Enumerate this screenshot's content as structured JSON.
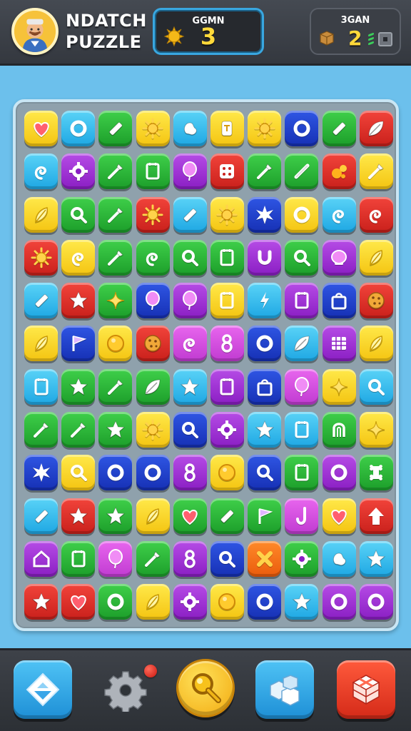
{
  "header": {
    "title_line1": "NDATCH",
    "title_line2": "PUZZLE",
    "score": {
      "label": "GGMN",
      "value": "3"
    },
    "moves": {
      "label": "3GAN",
      "value": "2"
    }
  },
  "colors": {
    "yellow": "#f4c411",
    "blue": "#1ea7e3",
    "green": "#1c9e2a",
    "red": "#c9201b",
    "purple": "#8a1ec3",
    "navy": "#1630b4",
    "orange": "#ea5b0c",
    "magenta": "#c03bd1",
    "board": "#8fa1ac",
    "background": "#6cc0ec"
  },
  "board": {
    "rows": 12,
    "cols": 10,
    "tiles": [
      [
        "yellow:heart",
        "blue:ring",
        "green:bar",
        "yellow:sun",
        "blue:bean",
        "yellow:tag",
        "yellow:sun",
        "navy:ring",
        "green:bar",
        "red:leaf"
      ],
      [
        "blue:swirl",
        "purple:gear",
        "green:wand",
        "green:note",
        "purple:balloon",
        "red:dice",
        "green:wand",
        "green:needle",
        "red:splat",
        "yellow:wand"
      ],
      [
        "yellow:feather",
        "green:magnifier",
        "green:wand",
        "red:sun",
        "blue:bar",
        "yellow:sun",
        "navy:burst",
        "yellow:ring",
        "blue:swirl",
        "red:swirl"
      ],
      [
        "red:sun",
        "yellow:swirl",
        "green:wand",
        "green:swirl",
        "green:magnifier",
        "green:note",
        "purple:horseshoe",
        "green:magnifier",
        "purple:blob",
        "yellow:feather"
      ],
      [
        "blue:bar",
        "red:star",
        "green:sparkle",
        "navy:balloon",
        "purple:balloon",
        "yellow:note",
        "blue:bolt",
        "purple:note",
        "navy:bag",
        "red:cookie"
      ],
      [
        "yellow:feather",
        "navy:flag",
        "yellow:coin",
        "red:cookie",
        "magenta:swirl",
        "magenta:eight",
        "navy:ring",
        "blue:leaf",
        "purple:grid",
        "yellow:feather"
      ],
      [
        "blue:note",
        "green:star",
        "green:wand",
        "green:leaf",
        "blue:star",
        "purple:note",
        "navy:bag",
        "magenta:balloon",
        "yellow:sparkle",
        "blue:magnifier"
      ],
      [
        "green:wand",
        "green:wand",
        "green:star",
        "yellow:sun",
        "navy:magnifier",
        "purple:gear",
        "blue:star",
        "blue:note",
        "green:arch",
        "yellow:sparkle"
      ],
      [
        "navy:burst",
        "yellow:magnifier",
        "navy:ring",
        "navy:ring",
        "purple:eight",
        "yellow:coin",
        "navy:magnifier",
        "green:note",
        "purple:ring",
        "green:bone"
      ],
      [
        "blue:bar",
        "red:star",
        "green:star",
        "yellow:feather",
        "green:heart",
        "green:bar",
        "green:flag",
        "magenta:hook",
        "yellow:heart",
        "red:arrow"
      ],
      [
        "purple:house",
        "green:note",
        "magenta:balloon",
        "green:wand",
        "purple:eight",
        "navy:magnifier",
        "orange:cross",
        "green:gear",
        "blue:bean",
        "blue:star"
      ],
      [
        "red:star",
        "red:heart",
        "green:ring",
        "yellow:feather",
        "purple:gear",
        "yellow:coin",
        "navy:ring",
        "blue:star",
        "purple:ring",
        "purple:ring"
      ]
    ]
  },
  "toolbar": {
    "buttons": [
      {
        "name": "diamond-button",
        "icon": "diamond-icon"
      },
      {
        "name": "settings-button",
        "icon": "gear-icon"
      },
      {
        "name": "hint-button",
        "icon": "magnifier-icon"
      },
      {
        "name": "boxes-button",
        "icon": "boxes-icon"
      },
      {
        "name": "shuffle-button",
        "icon": "cube-icon"
      }
    ]
  }
}
